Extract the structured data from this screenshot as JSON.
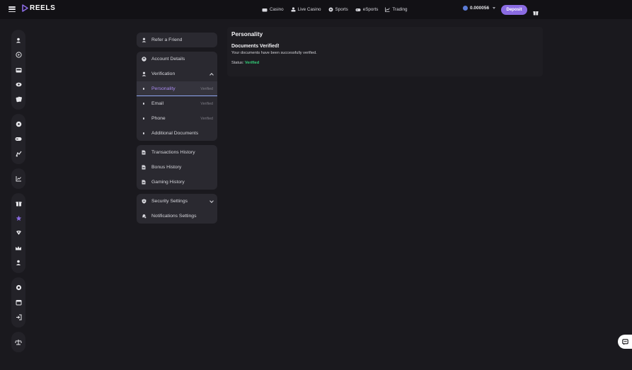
{
  "brand": {
    "name": "REELS",
    "accent": "#8a6be2"
  },
  "topnav": [
    {
      "label": "Casino",
      "icon": "cards-icon"
    },
    {
      "label": "Live Casino",
      "icon": "live-casino-icon"
    },
    {
      "label": "Sports",
      "icon": "soccer-ball-icon"
    },
    {
      "label": "eSports",
      "icon": "gamepad-icon"
    },
    {
      "label": "Trading",
      "icon": "chart-icon"
    }
  ],
  "wallet": {
    "balance": "0.000056",
    "deposit_label": "Deposit"
  },
  "rail": [
    [
      "user-icon",
      "promotions-icon",
      "slots-icon",
      "live-icon",
      "cards-icon"
    ],
    [
      "soccer-icon",
      "gamepad-icon",
      "racing-icon"
    ],
    [
      "chart-icon"
    ],
    [
      "gift-icon",
      "vip-icon",
      "wheel-icon",
      "crown-icon",
      "referral-icon"
    ],
    [
      "support-icon",
      "calendar-icon",
      "logout-icon"
    ],
    [
      "balance-icon"
    ]
  ],
  "menu": {
    "refer": "Refer a Friend",
    "account_details": "Account Details",
    "verification": "Verification",
    "personality": "Personality",
    "personality_status": "Verified",
    "email": "Email",
    "email_status": "Verified",
    "phone": "Phone",
    "phone_status": "Verified",
    "additional_documents": "Additional Documents",
    "transactions_history": "Transactions History",
    "bonus_history": "Bonus History",
    "gaming_history": "Gaming History",
    "security_settings": "Security Settings",
    "notifications_settings": "Notifications Settings"
  },
  "content": {
    "title": "Personality",
    "heading": "Documents Verified!",
    "message": "Your documents have been successfully verified.",
    "status_label": "Status:",
    "status_value": "Verified",
    "status_color": "#33d17a"
  }
}
